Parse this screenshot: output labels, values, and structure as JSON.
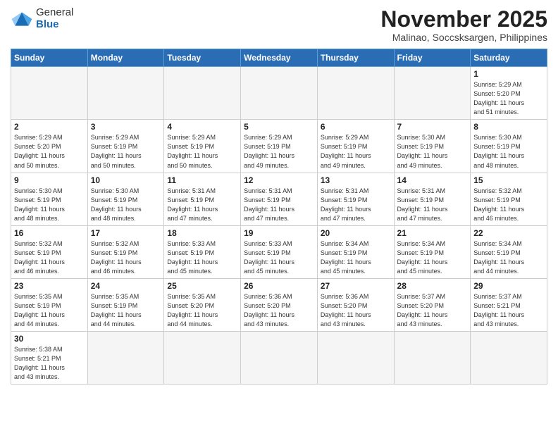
{
  "header": {
    "logo_general": "General",
    "logo_blue": "Blue",
    "month_title": "November 2025",
    "location": "Malinao, Soccsksargen, Philippines"
  },
  "weekdays": [
    "Sunday",
    "Monday",
    "Tuesday",
    "Wednesday",
    "Thursday",
    "Friday",
    "Saturday"
  ],
  "weeks": [
    [
      {
        "day": "",
        "info": ""
      },
      {
        "day": "",
        "info": ""
      },
      {
        "day": "",
        "info": ""
      },
      {
        "day": "",
        "info": ""
      },
      {
        "day": "",
        "info": ""
      },
      {
        "day": "",
        "info": ""
      },
      {
        "day": "1",
        "info": "Sunrise: 5:29 AM\nSunset: 5:20 PM\nDaylight: 11 hours\nand 51 minutes."
      }
    ],
    [
      {
        "day": "2",
        "info": "Sunrise: 5:29 AM\nSunset: 5:20 PM\nDaylight: 11 hours\nand 50 minutes."
      },
      {
        "day": "3",
        "info": "Sunrise: 5:29 AM\nSunset: 5:19 PM\nDaylight: 11 hours\nand 50 minutes."
      },
      {
        "day": "4",
        "info": "Sunrise: 5:29 AM\nSunset: 5:19 PM\nDaylight: 11 hours\nand 50 minutes."
      },
      {
        "day": "5",
        "info": "Sunrise: 5:29 AM\nSunset: 5:19 PM\nDaylight: 11 hours\nand 49 minutes."
      },
      {
        "day": "6",
        "info": "Sunrise: 5:29 AM\nSunset: 5:19 PM\nDaylight: 11 hours\nand 49 minutes."
      },
      {
        "day": "7",
        "info": "Sunrise: 5:30 AM\nSunset: 5:19 PM\nDaylight: 11 hours\nand 49 minutes."
      },
      {
        "day": "8",
        "info": "Sunrise: 5:30 AM\nSunset: 5:19 PM\nDaylight: 11 hours\nand 48 minutes."
      }
    ],
    [
      {
        "day": "9",
        "info": "Sunrise: 5:30 AM\nSunset: 5:19 PM\nDaylight: 11 hours\nand 48 minutes."
      },
      {
        "day": "10",
        "info": "Sunrise: 5:30 AM\nSunset: 5:19 PM\nDaylight: 11 hours\nand 48 minutes."
      },
      {
        "day": "11",
        "info": "Sunrise: 5:31 AM\nSunset: 5:19 PM\nDaylight: 11 hours\nand 47 minutes."
      },
      {
        "day": "12",
        "info": "Sunrise: 5:31 AM\nSunset: 5:19 PM\nDaylight: 11 hours\nand 47 minutes."
      },
      {
        "day": "13",
        "info": "Sunrise: 5:31 AM\nSunset: 5:19 PM\nDaylight: 11 hours\nand 47 minutes."
      },
      {
        "day": "14",
        "info": "Sunrise: 5:31 AM\nSunset: 5:19 PM\nDaylight: 11 hours\nand 47 minutes."
      },
      {
        "day": "15",
        "info": "Sunrise: 5:32 AM\nSunset: 5:19 PM\nDaylight: 11 hours\nand 46 minutes."
      }
    ],
    [
      {
        "day": "16",
        "info": "Sunrise: 5:32 AM\nSunset: 5:19 PM\nDaylight: 11 hours\nand 46 minutes."
      },
      {
        "day": "17",
        "info": "Sunrise: 5:32 AM\nSunset: 5:19 PM\nDaylight: 11 hours\nand 46 minutes."
      },
      {
        "day": "18",
        "info": "Sunrise: 5:33 AM\nSunset: 5:19 PM\nDaylight: 11 hours\nand 45 minutes."
      },
      {
        "day": "19",
        "info": "Sunrise: 5:33 AM\nSunset: 5:19 PM\nDaylight: 11 hours\nand 45 minutes."
      },
      {
        "day": "20",
        "info": "Sunrise: 5:34 AM\nSunset: 5:19 PM\nDaylight: 11 hours\nand 45 minutes."
      },
      {
        "day": "21",
        "info": "Sunrise: 5:34 AM\nSunset: 5:19 PM\nDaylight: 11 hours\nand 45 minutes."
      },
      {
        "day": "22",
        "info": "Sunrise: 5:34 AM\nSunset: 5:19 PM\nDaylight: 11 hours\nand 44 minutes."
      }
    ],
    [
      {
        "day": "23",
        "info": "Sunrise: 5:35 AM\nSunset: 5:19 PM\nDaylight: 11 hours\nand 44 minutes."
      },
      {
        "day": "24",
        "info": "Sunrise: 5:35 AM\nSunset: 5:19 PM\nDaylight: 11 hours\nand 44 minutes."
      },
      {
        "day": "25",
        "info": "Sunrise: 5:35 AM\nSunset: 5:20 PM\nDaylight: 11 hours\nand 44 minutes."
      },
      {
        "day": "26",
        "info": "Sunrise: 5:36 AM\nSunset: 5:20 PM\nDaylight: 11 hours\nand 43 minutes."
      },
      {
        "day": "27",
        "info": "Sunrise: 5:36 AM\nSunset: 5:20 PM\nDaylight: 11 hours\nand 43 minutes."
      },
      {
        "day": "28",
        "info": "Sunrise: 5:37 AM\nSunset: 5:20 PM\nDaylight: 11 hours\nand 43 minutes."
      },
      {
        "day": "29",
        "info": "Sunrise: 5:37 AM\nSunset: 5:21 PM\nDaylight: 11 hours\nand 43 minutes."
      }
    ],
    [
      {
        "day": "30",
        "info": "Sunrise: 5:38 AM\nSunset: 5:21 PM\nDaylight: 11 hours\nand 43 minutes."
      },
      {
        "day": "",
        "info": ""
      },
      {
        "day": "",
        "info": ""
      },
      {
        "day": "",
        "info": ""
      },
      {
        "day": "",
        "info": ""
      },
      {
        "day": "",
        "info": ""
      },
      {
        "day": "",
        "info": ""
      }
    ]
  ]
}
